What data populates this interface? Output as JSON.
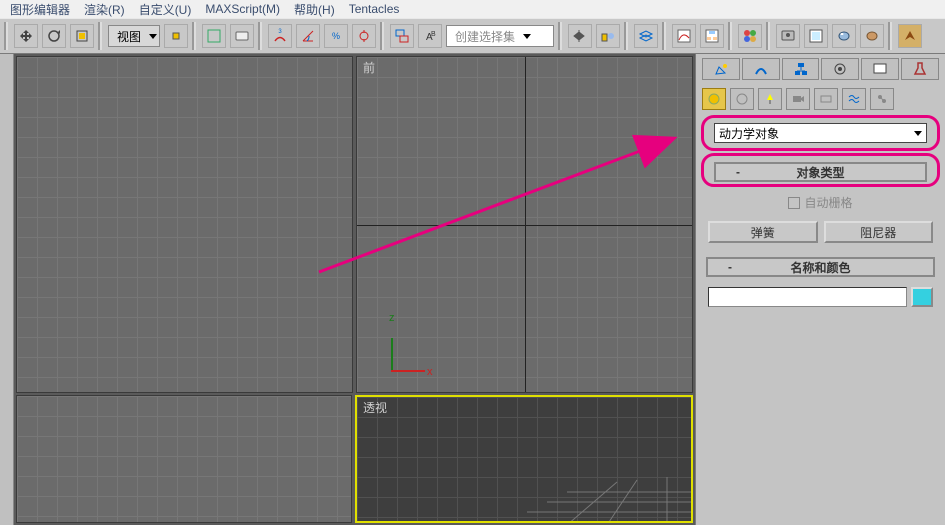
{
  "menu": {
    "items": [
      "图形编辑器",
      "渲染(R)",
      "自定义(U)",
      "MAXScript(M)",
      "帮助(H)",
      "Tentacles"
    ]
  },
  "toolbar": {
    "view_label": "视图",
    "selset_placeholder": "创建选择集"
  },
  "viewports": {
    "front_label": "前",
    "persp_label": "透视",
    "axis_x": "x",
    "axis_z": "z"
  },
  "panel": {
    "dropdown": "动力学对象",
    "rollout_objtype": "对象类型",
    "autogrid": "自动栅格",
    "btn_spring": "弹簧",
    "btn_damper": "阻尼器",
    "rollout_name": "名称和颜色"
  },
  "accent": "#e6007e"
}
